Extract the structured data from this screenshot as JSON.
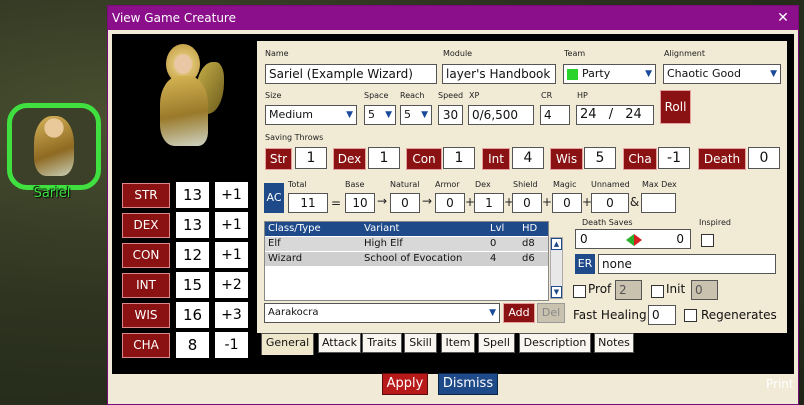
{
  "token": {
    "name": "Sariel"
  },
  "window": {
    "title": "View Game Creature",
    "close": "✕"
  },
  "abilities": [
    {
      "label": "STR",
      "score": "13",
      "mod": "+1"
    },
    {
      "label": "DEX",
      "score": "13",
      "mod": "+1"
    },
    {
      "label": "CON",
      "score": "12",
      "mod": "+1"
    },
    {
      "label": "INT",
      "score": "15",
      "mod": "+2"
    },
    {
      "label": "WIS",
      "score": "16",
      "mod": "+3"
    },
    {
      "label": "CHA",
      "score": "8",
      "mod": "-1"
    }
  ],
  "fields": {
    "name_label": "Name",
    "name": "Sariel (Example Wizard)",
    "module_label": "Module",
    "module": "layer's Handbook",
    "team_label": "Team",
    "team": "Party",
    "team_color": "#2bd42b",
    "alignment_label": "Alignment",
    "alignment": "Chaotic Good",
    "size_label": "Size",
    "size": "Medium",
    "space_label": "Space",
    "space": "5",
    "reach_label": "Reach",
    "reach": "5",
    "speed_label": "Speed",
    "speed": "30",
    "xp_label": "XP",
    "xp": "0/6,500",
    "cr_label": "CR",
    "cr": "4",
    "hp_label": "HP",
    "hp_cur": "24",
    "hp_sep": "/",
    "hp_max": "24",
    "roll": "Roll"
  },
  "saves": {
    "label": "Saving Throws",
    "items": [
      {
        "label": "Str",
        "val": "1"
      },
      {
        "label": "Dex",
        "val": "1"
      },
      {
        "label": "Con",
        "val": "1"
      },
      {
        "label": "Int",
        "val": "4"
      },
      {
        "label": "Wis",
        "val": "5"
      },
      {
        "label": "Cha",
        "val": "-1"
      },
      {
        "label": "Death",
        "val": "0"
      }
    ]
  },
  "ac": {
    "badge": "AC",
    "total_label": "Total",
    "total": "11",
    "eq": "=",
    "base_label": "Base",
    "base": "10",
    "natural_label": "Natural",
    "natural": "0",
    "armor_label": "Armor",
    "armor": "0",
    "dex_label": "Dex",
    "dex": "1",
    "shield_label": "Shield",
    "shield": "0",
    "magic_label": "Magic",
    "magic": "0",
    "unnamed_label": "Unnamed",
    "unnamed": "0",
    "maxdex_label": "Max Dex",
    "maxdex": "",
    "amp": "&"
  },
  "classes": {
    "headers": [
      "Class/Type",
      "Variant",
      "Lvl",
      "HD"
    ],
    "rows": [
      [
        "Elf",
        "High Elf",
        "0",
        "d8"
      ],
      [
        "Wizard",
        "School of Evocation",
        "4",
        "d6"
      ]
    ],
    "dropdown": "Aarakocra",
    "add": "Add",
    "del": "Del"
  },
  "death_saves": {
    "label": "Death Saves",
    "left": "0",
    "right": "0"
  },
  "inspired": "Inspired",
  "er": {
    "label": "ER",
    "value": "none"
  },
  "prof": {
    "label": "Prof",
    "value": "2"
  },
  "init": {
    "label": "Init",
    "value": "0"
  },
  "fast_healing": {
    "label": "Fast Healing",
    "value": "0"
  },
  "regenerates": "Regenerates",
  "tabs": [
    "General",
    "Attack",
    "Traits",
    "Skill",
    "Item",
    "Spell",
    "Description",
    "Notes"
  ],
  "buttons": {
    "apply": "Apply",
    "dismiss": "Dismiss",
    "print": "Print"
  }
}
